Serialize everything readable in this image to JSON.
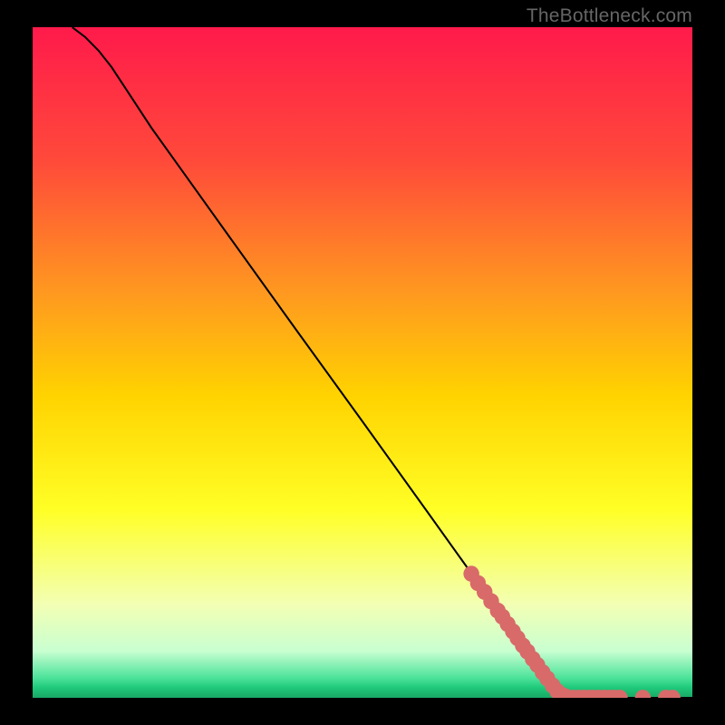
{
  "watermark": "TheBottleneck.com",
  "chart_data": {
    "type": "line",
    "title": "",
    "xlabel": "",
    "ylabel": "",
    "xlim": [
      0,
      100
    ],
    "ylim": [
      0,
      100
    ],
    "curve": {
      "x": [
        6,
        8,
        10,
        12,
        14,
        18,
        22,
        30,
        40,
        50,
        60,
        68,
        76,
        80,
        82,
        84,
        100
      ],
      "y": [
        100,
        98.5,
        96.5,
        94,
        91,
        85,
        79.5,
        68.5,
        54.8,
        41.2,
        27.5,
        16.5,
        5.5,
        1,
        0.3,
        0,
        0
      ]
    },
    "highlight_points": {
      "x": [
        66.5,
        67.5,
        68.5,
        69.5,
        70.5,
        71.2,
        72.0,
        72.8,
        73.5,
        74.3,
        75.0,
        75.8,
        76.5,
        77.3,
        78.0,
        78.8,
        79.5,
        80.2,
        80.8,
        82.0,
        82.8,
        83.5,
        84.3,
        85.0,
        85.8,
        86.6,
        87.4,
        88.2,
        89.0,
        92.5,
        96.0,
        97.0
      ],
      "y": [
        18.5,
        17.1,
        15.8,
        14.4,
        13.0,
        12.1,
        11.0,
        9.9,
        8.9,
        7.8,
        6.9,
        5.8,
        4.9,
        3.8,
        2.9,
        1.85,
        1.0,
        0.45,
        0.2,
        0,
        0,
        0,
        0,
        0,
        0,
        0,
        0,
        0,
        0,
        0,
        0,
        0
      ],
      "color": "#d86a6a",
      "radius_fraction": 0.012
    },
    "background_gradient": {
      "stops": [
        {
          "offset": 0.0,
          "color": "#ff1a4b"
        },
        {
          "offset": 0.2,
          "color": "#ff4a3a"
        },
        {
          "offset": 0.4,
          "color": "#ff9a1f"
        },
        {
          "offset": 0.55,
          "color": "#ffd300"
        },
        {
          "offset": 0.72,
          "color": "#ffff26"
        },
        {
          "offset": 0.86,
          "color": "#f3ffb3"
        },
        {
          "offset": 0.93,
          "color": "#c9ffd1"
        },
        {
          "offset": 0.97,
          "color": "#4de39a"
        },
        {
          "offset": 0.985,
          "color": "#1fc97a"
        },
        {
          "offset": 1.0,
          "color": "#19a866"
        }
      ]
    }
  }
}
